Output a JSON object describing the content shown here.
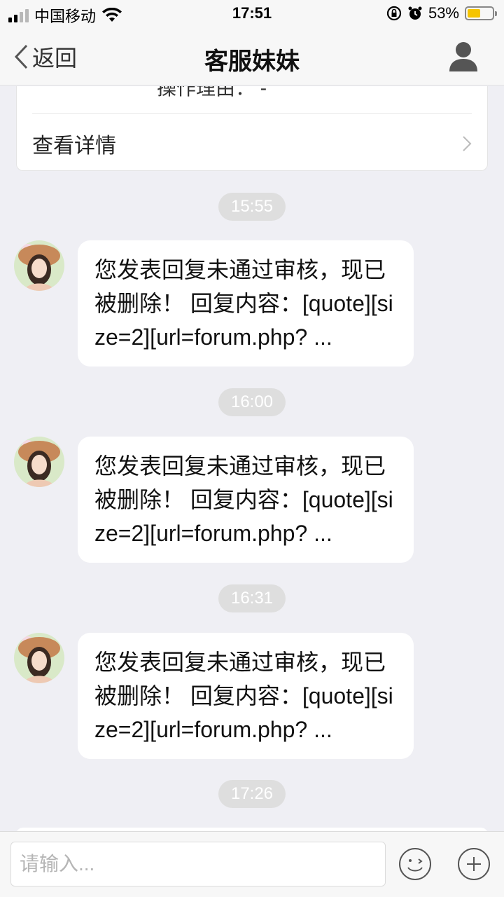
{
  "status": {
    "carrier": "中国移动",
    "time": "17:51",
    "battery_percent": "53%",
    "battery_level": 0.53,
    "battery_color": "#f5c400"
  },
  "nav": {
    "back_label": "返回",
    "title": "客服妹妹"
  },
  "card": {
    "reason_partial": "操作理由： -",
    "detail_label": "查看详情"
  },
  "messages": [
    {
      "time": "15:55",
      "text": "您发表回复未通过审核，现已被删除！ 回复内容：[quote][size=2][url=forum.php? ..."
    },
    {
      "time": "16:00",
      "text": "您发表回复未通过审核，现已被删除！ 回复内容：[quote][size=2][url=forum.php? ..."
    },
    {
      "time": "16:31",
      "text": "您发表回复未通过审核，现已被删除！ 回复内容：[quote][size=2][url=forum.php? ..."
    }
  ],
  "last_time": "17:26",
  "input": {
    "placeholder": "请输入..."
  },
  "icons": {
    "back": "chevron-left-icon",
    "user": "user-profile-icon",
    "emoji": "emoji-icon",
    "add": "plus-icon"
  }
}
